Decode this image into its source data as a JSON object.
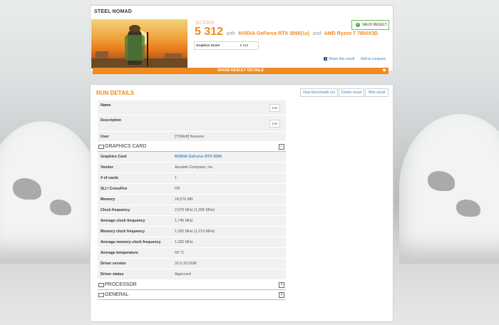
{
  "header": {
    "title": "STEEL NOMAD",
    "score_label": "SCORE",
    "score_value": "5 312",
    "with_text": "with",
    "gpu": "NVIDIA GeForce RTX 3090(1x)",
    "and_text": "and",
    "cpu": "AMD Ryzen 7 7800X3D",
    "graphics_score_label": "Graphics Score",
    "graphics_score_value": "5 312",
    "valid_badge": "VALID RESULT",
    "valid_icon": "check-icon",
    "share_label": "Share this result",
    "compare_label": "Add to compare",
    "show_details_label": "SHOW RESULT DETAILS"
  },
  "run_details": {
    "title": "RUN DETAILS",
    "buttons": [
      "View benchmark run",
      "Delete result",
      "Hide result"
    ],
    "top_rows": [
      {
        "key": "Name",
        "value": "",
        "edit": "Edit"
      },
      {
        "key": "Description",
        "value": "",
        "edit": "Edit"
      },
      {
        "key": "User",
        "value": "[TSWolf] Nexures"
      }
    ],
    "sections": {
      "graphics": "GRAPHICS CARD",
      "processor": "PROCESSOR",
      "general": "GENERAL"
    },
    "graphics_rows": [
      {
        "key": "Graphics Card",
        "value": "NVIDIA GeForce RTX 3090"
      },
      {
        "key": "Vendor",
        "value": "Asustek Computer, Inc."
      },
      {
        "key": "# of cards",
        "value": "1"
      },
      {
        "key": "SLI / CrossFire",
        "value": "Off"
      },
      {
        "key": "Memory",
        "value": "24,576 MB"
      },
      {
        "key": "Clock frequency",
        "value": "2,070 MHz (1,395 MHz)"
      },
      {
        "key": "Average clock frequency",
        "value": "1,745 MHz"
      },
      {
        "key": "Memory clock frequency",
        "value": "1,282 MHz (1,219 MHz)"
      },
      {
        "key": "Average memory clock frequency",
        "value": "1,282 MHz"
      },
      {
        "key": "Average temperature",
        "value": "69 °C"
      },
      {
        "key": "Driver version",
        "value": "32.0.15.9186"
      },
      {
        "key": "Driver status",
        "value": "Approved"
      }
    ]
  },
  "colors": {
    "accent": "#ef8a1a",
    "link": "#3b86c4",
    "valid": "#4caa36"
  }
}
